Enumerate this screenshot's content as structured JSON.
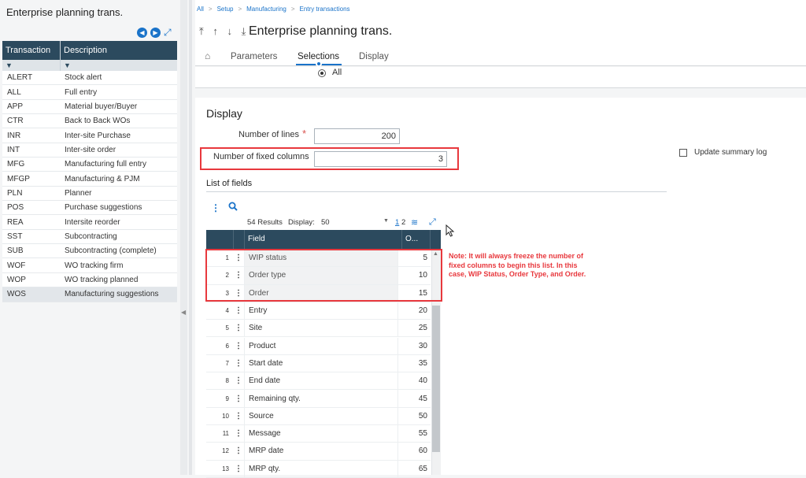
{
  "left_panel": {
    "title": "Enterprise planning trans.",
    "icons": {
      "prev": "chevron-left-circle-icon",
      "next": "chevron-right-circle-icon",
      "expand": "expand-icon"
    },
    "columns": [
      "Transaction",
      "Description"
    ],
    "rows": [
      {
        "code": "ALERT",
        "desc": "Stock alert"
      },
      {
        "code": "ALL",
        "desc": "Full entry"
      },
      {
        "code": "APP",
        "desc": "Material buyer/Buyer"
      },
      {
        "code": "CTR",
        "desc": "Back to Back WOs"
      },
      {
        "code": "INR",
        "desc": "Inter-site Purchase"
      },
      {
        "code": "INT",
        "desc": "Inter-site order"
      },
      {
        "code": "MFG",
        "desc": "Manufacturing full entry"
      },
      {
        "code": "MFGP",
        "desc": "Manufacturing & PJM"
      },
      {
        "code": "PLN",
        "desc": "Planner"
      },
      {
        "code": "POS",
        "desc": "Purchase suggestions"
      },
      {
        "code": "REA",
        "desc": "Intersite reorder"
      },
      {
        "code": "SST",
        "desc": "Subcontracting"
      },
      {
        "code": "SUB",
        "desc": "Subcontracting (complete)"
      },
      {
        "code": "WOF",
        "desc": "WO tracking firm"
      },
      {
        "code": "WOP",
        "desc": "WO tracking planned"
      },
      {
        "code": "WOS",
        "desc": "Manufacturing suggestions"
      }
    ],
    "selected_code": "WOS"
  },
  "breadcrumb": [
    "All",
    "Setup",
    "Manufacturing",
    "Entry transactions"
  ],
  "header": {
    "title": "Enterprise planning trans.",
    "nav_arrows": "⤒ ↑ ↓ ⤓",
    "tabs": [
      "Parameters",
      "Selections",
      "Display"
    ],
    "active_tab": "Selections"
  },
  "selections": {
    "radio_all_label": "All"
  },
  "display": {
    "section_title": "Display",
    "number_of_lines_label": "Number of lines",
    "number_of_lines_value": "200",
    "fixed_columns_label": "Number of fixed columns",
    "fixed_columns_value": "3",
    "update_summary_label": "Update summary log",
    "list_title": "List of fields"
  },
  "grid_toolbar": {
    "results": "54 Results",
    "display_label": "Display:",
    "display_value": "50",
    "pages": [
      "1",
      "2"
    ]
  },
  "grid": {
    "columns": [
      "Field",
      "O..."
    ],
    "rows": [
      {
        "n": "1",
        "field": "WIP status",
        "o": "5"
      },
      {
        "n": "2",
        "field": "Order type",
        "o": "10"
      },
      {
        "n": "3",
        "field": "Order",
        "o": "15"
      },
      {
        "n": "4",
        "field": "Entry",
        "o": "20"
      },
      {
        "n": "5",
        "field": "Site",
        "o": "25"
      },
      {
        "n": "6",
        "field": "Product",
        "o": "30"
      },
      {
        "n": "7",
        "field": "Start date",
        "o": "35"
      },
      {
        "n": "8",
        "field": "End date",
        "o": "40"
      },
      {
        "n": "9",
        "field": "Remaining qty.",
        "o": "45"
      },
      {
        "n": "10",
        "field": "Source",
        "o": "50"
      },
      {
        "n": "11",
        "field": "Message",
        "o": "55"
      },
      {
        "n": "12",
        "field": "MRP date",
        "o": "60"
      },
      {
        "n": "13",
        "field": "MRP qty.",
        "o": "65"
      }
    ],
    "frozen_count": 3
  },
  "annotation": {
    "note": "Note: It will always freeze the number of fixed columns to begin this list.  In this case, WIP Status, Order Type, and Order.",
    "color": "#e8383d"
  },
  "colors": {
    "accent": "#1a73c9",
    "header_dark": "#2c4a5e",
    "highlight": "#e8383d"
  }
}
